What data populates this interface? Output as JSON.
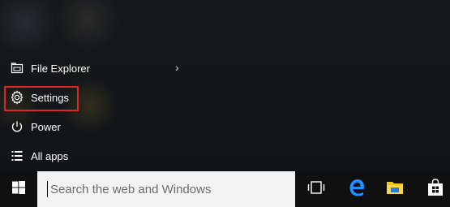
{
  "start_menu": {
    "items": [
      {
        "label": "File Explorer",
        "icon": "file-explorer-icon",
        "has_submenu": true
      },
      {
        "label": "Settings",
        "icon": "gear-icon",
        "highlighted": true
      },
      {
        "label": "Power",
        "icon": "power-icon"
      },
      {
        "label": "All apps",
        "icon": "all-apps-icon"
      }
    ],
    "highlight_color": "#e0242b"
  },
  "taskbar": {
    "start_icon": "windows-logo-icon",
    "search": {
      "value": "",
      "placeholder": "Search the web and Windows"
    },
    "pinned": [
      {
        "name": "task-view",
        "icon": "task-view-icon"
      },
      {
        "name": "edge",
        "icon": "edge-icon",
        "color": "#1e90ff"
      },
      {
        "name": "file-explorer",
        "icon": "folder-icon",
        "color": "#f5c518"
      },
      {
        "name": "store",
        "icon": "store-icon"
      }
    ]
  }
}
